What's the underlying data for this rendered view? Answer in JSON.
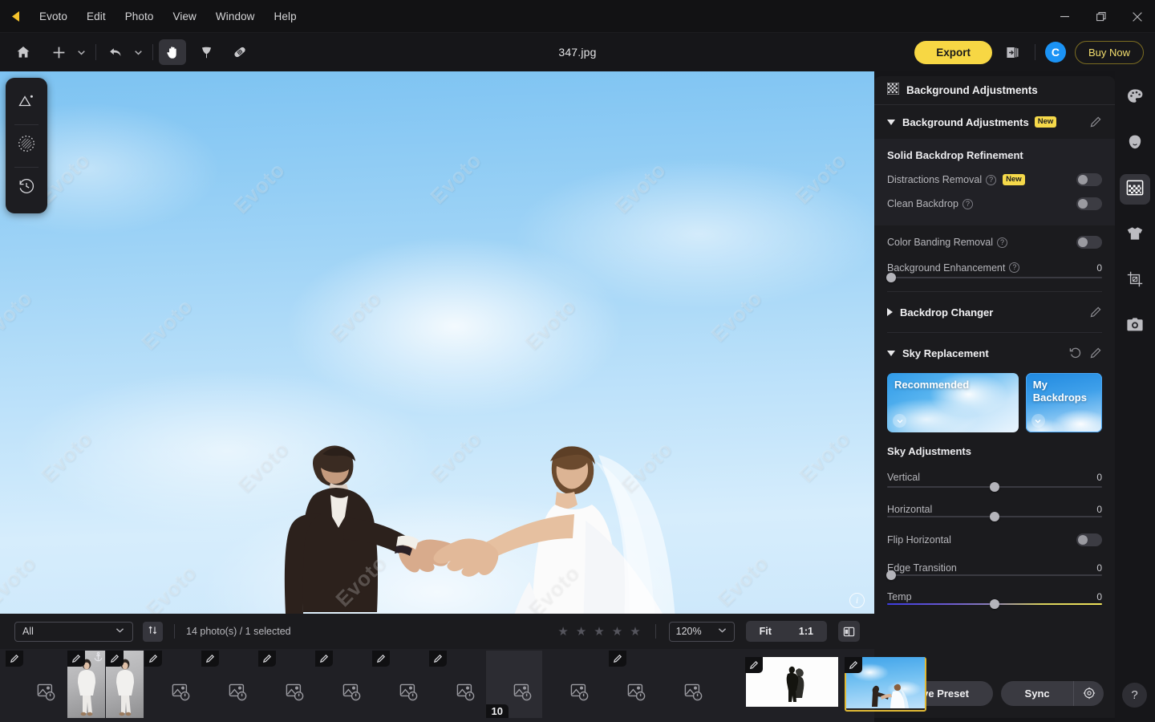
{
  "app": {
    "name": "Evoto",
    "document_title": "347.jpg",
    "logo_icon": "evoto-logo-icon"
  },
  "menubar": {
    "items": [
      {
        "label": "Evoto"
      },
      {
        "label": "Edit"
      },
      {
        "label": "Photo"
      },
      {
        "label": "View"
      },
      {
        "label": "Window"
      },
      {
        "label": "Help"
      }
    ]
  },
  "window_controls": [
    {
      "name": "minimize",
      "icon": "minimize-icon"
    },
    {
      "name": "maximize",
      "icon": "maximize-icon"
    },
    {
      "name": "close",
      "icon": "close-icon"
    }
  ],
  "toolbar": {
    "home": "home-icon",
    "add": "plus-icon",
    "add_caret": "chevron-down-icon",
    "undo": "undo-arrow-icon",
    "undo_caret": "chevron-down-icon",
    "hand": "hand-tool-icon",
    "blemish": "spot-heal-icon",
    "bandage": "bandage-tool-icon",
    "export_label": "Export",
    "share_icon": "share-export-icon",
    "avatar_initial": "C",
    "buy_label": "Buy Now"
  },
  "left_dock": {
    "items": [
      {
        "name": "retouch-landscape-tool",
        "icon": "landscape-adjust-icon"
      },
      {
        "name": "mask-brush-tool",
        "icon": "dotted-circle-icon"
      },
      {
        "name": "history-tool",
        "icon": "history-clock-icon"
      }
    ]
  },
  "canvas": {
    "watermark_text": "Evoto",
    "info_badge": "i",
    "subject": "wedding couple reaching hands on blue sky background"
  },
  "right_panel": {
    "header": {
      "title": "Background Adjustments",
      "icon": "checkerboard-icon"
    },
    "sections": [
      {
        "title": "Background Adjustments",
        "badge": "New",
        "expanded": true,
        "edit_icon": "pencil-edit-icon",
        "subtitle": "Solid Backdrop Refinement",
        "controls": [
          {
            "type": "toggle",
            "label": "Distractions Removal",
            "help": "?",
            "badge": "New",
            "value": false
          },
          {
            "type": "toggle",
            "label": "Clean Backdrop",
            "help": "?",
            "value": false
          },
          {
            "type": "toggle",
            "label": "Color Banding Removal",
            "help": "?",
            "value": false
          },
          {
            "type": "slider",
            "label": "Background Enhancement",
            "help": "?",
            "value": "0",
            "pos": 0
          }
        ]
      },
      {
        "title": "Backdrop Changer",
        "expanded": false,
        "edit_icon": "pencil-edit-icon"
      },
      {
        "title": "Sky Replacement",
        "expanded": true,
        "reset_icon": "reset-circular-arrow-icon",
        "edit_icon": "pencil-edit-icon",
        "tiles": [
          {
            "label": "Recommended",
            "selected": false,
            "chevron": "chevron-down-icon"
          },
          {
            "label": "My Backdrops",
            "selected": true,
            "chevron": "chevron-down-icon"
          }
        ],
        "subtitle": "Sky Adjustments",
        "controls": [
          {
            "type": "slider",
            "label": "Vertical",
            "value": "0",
            "pos": 50
          },
          {
            "type": "slider",
            "label": "Horizontal",
            "value": "0",
            "pos": 50
          },
          {
            "type": "toggle",
            "label": "Flip Horizontal",
            "value": false
          },
          {
            "type": "slider",
            "label": "Edge Transition",
            "value": "0",
            "pos": 0
          },
          {
            "type": "slider_temp",
            "label": "Temp",
            "value": "0",
            "pos": 50
          }
        ]
      }
    ],
    "footer": {
      "save_preset_label": "Save Preset",
      "sync_label": "Sync",
      "sync_settings_icon": "gear-target-icon"
    }
  },
  "right_rail": {
    "items": [
      {
        "name": "color-palette-tool",
        "icon": "palette-icon",
        "active": false
      },
      {
        "name": "portrait-retouch-tool",
        "icon": "face-icon",
        "active": false
      },
      {
        "name": "background-tool",
        "icon": "checkerboard-icon",
        "active": true
      },
      {
        "name": "clothing-tool",
        "icon": "tshirt-icon",
        "active": false
      },
      {
        "name": "crop-tool",
        "icon": "crop-icon",
        "active": false
      },
      {
        "name": "camera-raw-tool",
        "icon": "camera-icon",
        "active": false
      }
    ],
    "help_icon": "question-mark-icon"
  },
  "bottom_bar": {
    "filter_value": "All",
    "filter_caret": "chevron-down-icon",
    "sort_icon": "sort-arrows-icon",
    "count_text": "14 photo(s) / 1 selected",
    "rating_stars": 5,
    "rating_value": 0,
    "zoom_value": "120%",
    "zoom_caret": "chevron-down-icon",
    "fit_label": "Fit",
    "one_to_one_label": "1:1",
    "compare_icon": "split-view-icon"
  },
  "filmstrip": {
    "number_badge": "10",
    "pen_icon": "pencil-edit-icon",
    "anchor_icon": "anchor-pin-icon",
    "placeholder_icon": "image-loading-icon",
    "thumbs": [
      {
        "kind": "placeholder",
        "pen": true
      },
      {
        "kind": "studio",
        "pen": true,
        "anchor": true
      },
      {
        "kind": "studio",
        "pen": true
      },
      {
        "kind": "placeholder",
        "pen": true
      },
      {
        "kind": "placeholder",
        "pen": true
      },
      {
        "kind": "placeholder",
        "pen": false
      },
      {
        "kind": "placeholder",
        "pen": false
      },
      {
        "kind": "placeholder",
        "pen": false
      },
      {
        "kind": "placeholder",
        "pen": false
      },
      {
        "kind": "empty",
        "number": "10"
      },
      {
        "kind": "placeholder",
        "pen": false
      },
      {
        "kind": "placeholder",
        "pen": true
      },
      {
        "kind": "placeholder",
        "pen": false
      },
      {
        "kind": "placeholder",
        "pen": false
      },
      {
        "kind": "white",
        "pen": true
      },
      {
        "kind": "sky",
        "pen": true,
        "selected": true
      }
    ]
  },
  "colors": {
    "accent_yellow": "#f7d744",
    "accent_blue": "#1b93f5",
    "panel_bg": "#1b1b1e",
    "selected_gold": "#e0b935"
  }
}
